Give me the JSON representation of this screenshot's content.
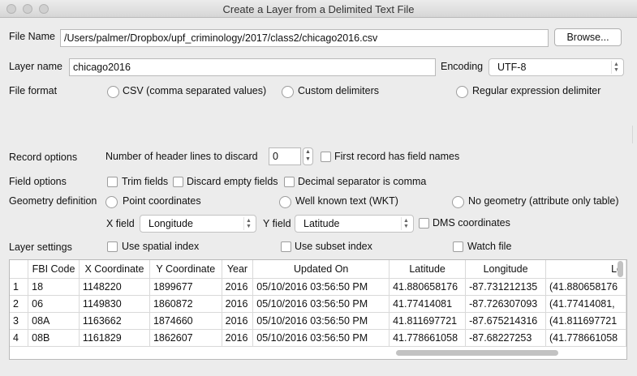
{
  "window": {
    "title": "Create a Layer from a Delimited Text File"
  },
  "file": {
    "label": "File Name",
    "value": "/Users/palmer/Dropbox/upf_criminology/2017/class2/chicago2016.csv",
    "browse_label": "Browse..."
  },
  "layer": {
    "label": "Layer name",
    "value": "chicago2016",
    "encoding_label": "Encoding",
    "encoding_value": "UTF-8"
  },
  "file_format": {
    "label": "File format",
    "options": [
      "CSV (comma separated values)",
      "Custom delimiters",
      "Regular expression delimiter"
    ]
  },
  "record_options": {
    "label": "Record options",
    "header_lines_label": "Number of header lines to discard",
    "header_lines_value": "0",
    "first_record_label": "First record has field names"
  },
  "field_options": {
    "label": "Field options",
    "trim_label": "Trim fields",
    "discard_empty_label": "Discard empty fields",
    "decimal_comma_label": "Decimal separator is comma"
  },
  "geometry": {
    "label": "Geometry definition",
    "options": [
      "Point coordinates",
      "Well known text (WKT)",
      "No geometry (attribute only table)"
    ],
    "x_field_label": "X field",
    "x_field_value": "Longitude",
    "y_field_label": "Y field",
    "y_field_value": "Latitude",
    "dms_label": "DMS coordinates"
  },
  "layer_settings": {
    "label": "Layer settings",
    "spatial_index_label": "Use spatial index",
    "subset_index_label": "Use subset index",
    "watch_file_label": "Watch file"
  },
  "preview": {
    "columns": [
      "FBI Code",
      "X Coordinate",
      "Y Coordinate",
      "Year",
      "Updated On",
      "Latitude",
      "Longitude",
      "Lo"
    ],
    "rows": [
      [
        "1",
        "18",
        "1148220",
        "1899677",
        "2016",
        "05/10/2016 03:56:50 PM",
        "41.880658176",
        "-87.731212135",
        "(41.880658176"
      ],
      [
        "2",
        "06",
        "1149830",
        "1860872",
        "2016",
        "05/10/2016 03:56:50 PM",
        "41.77414081",
        "-87.726307093",
        "(41.77414081,"
      ],
      [
        "3",
        "08A",
        "1163662",
        "1874660",
        "2016",
        "05/10/2016 03:56:50 PM",
        "41.811697721",
        "-87.675214316",
        "(41.811697721"
      ],
      [
        "4",
        "08B",
        "1161829",
        "1862607",
        "2016",
        "05/10/2016 03:56:50 PM",
        "41.778661058",
        "-87.68227253",
        "(41.778661058"
      ]
    ]
  }
}
